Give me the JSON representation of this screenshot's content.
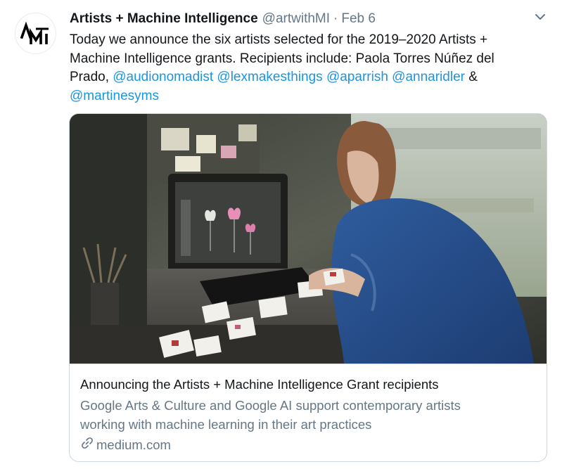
{
  "tweet": {
    "avatar_text": "AMI",
    "author_name": "Artists + Machine Intelligence",
    "handle": "@artwithMI",
    "separator": "·",
    "date": "Feb 6",
    "text_intro": "Today we announce the six artists selected for the 2019–2020 Artists + Machine Intelligence grants. Recipients include: Paola Torres Núñez del Prado, ",
    "mentions": [
      "@audionomadist",
      "@lexmakesthings",
      "@aparrish",
      "@annaridler",
      "@martinesyms"
    ],
    "ampersand": "&",
    "more_icon": "chevron-down-icon"
  },
  "card": {
    "image_description_icon": "photo-image",
    "title": "Announcing the Artists + Machine Intelligence Grant recipients",
    "description": "Google Arts & Culture and Google AI support contemporary artists working with machine learning in their art practices",
    "domain_icon": "link-icon",
    "domain": "medium.com"
  },
  "colors": {
    "link": "#1b95e0",
    "secondary_text": "#657786",
    "border": "#ccd6dd",
    "primary_text": "#14171a"
  }
}
